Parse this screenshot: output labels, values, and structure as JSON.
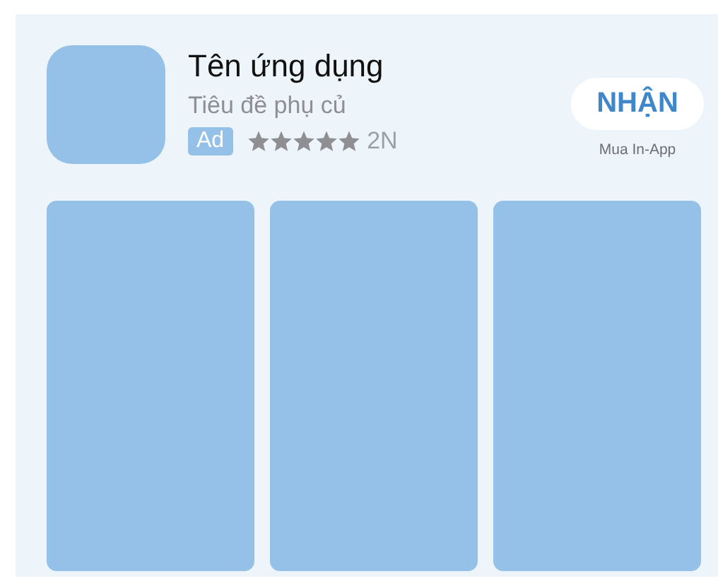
{
  "app": {
    "name": "Tên ứng dụng",
    "subtitle": "Tiêu đề phụ củ",
    "badge": "Ad",
    "stars": 5,
    "rating_count": "2N"
  },
  "get_button": {
    "label": "NHẬN",
    "note": "Mua In-App"
  },
  "screenshots": [
    {
      "kind": "placeholder"
    },
    {
      "kind": "placeholder"
    },
    {
      "kind": "placeholder"
    }
  ]
}
